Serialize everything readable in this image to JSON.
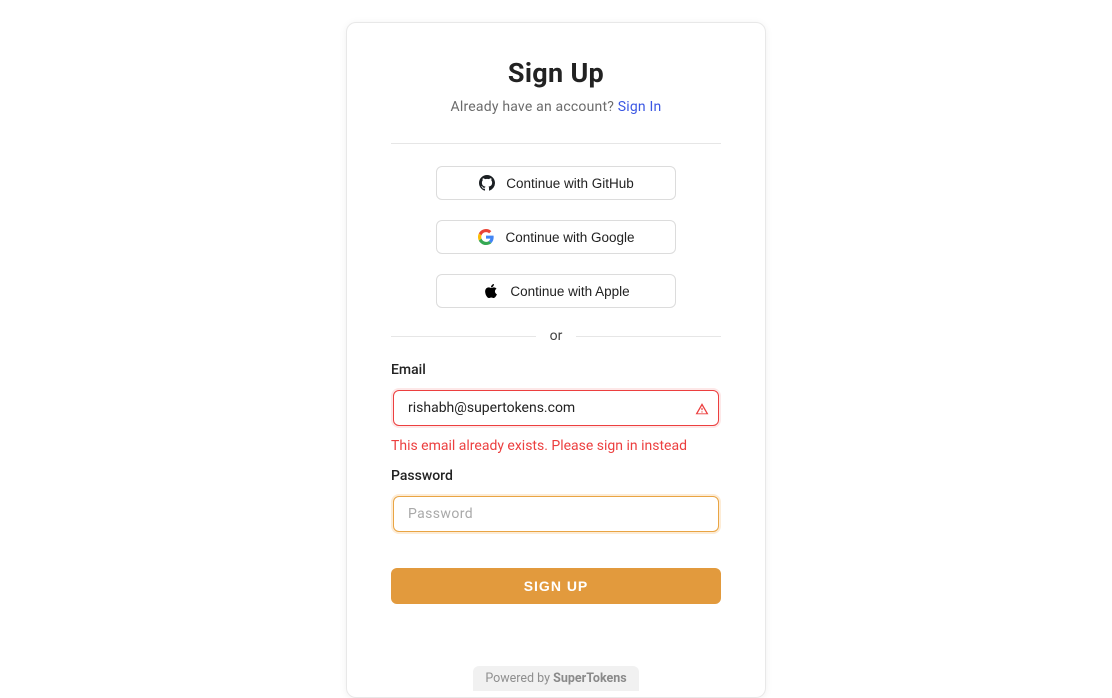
{
  "header": {
    "title": "Sign Up",
    "subtitle_prefix": "Already have an account? ",
    "signin_link": "Sign In"
  },
  "social": {
    "github": "Continue with GitHub",
    "google": "Continue with Google",
    "apple": "Continue with Apple"
  },
  "divider": {
    "or": "or"
  },
  "form": {
    "email_label": "Email",
    "email_value": "rishabh@supertokens.com",
    "email_error": "This email already exists. Please sign in instead",
    "password_label": "Password",
    "password_placeholder": "Password",
    "password_value": "",
    "submit_label": "SIGN UP"
  },
  "footer": {
    "prefix": "Powered by ",
    "brand": "SuperTokens"
  }
}
